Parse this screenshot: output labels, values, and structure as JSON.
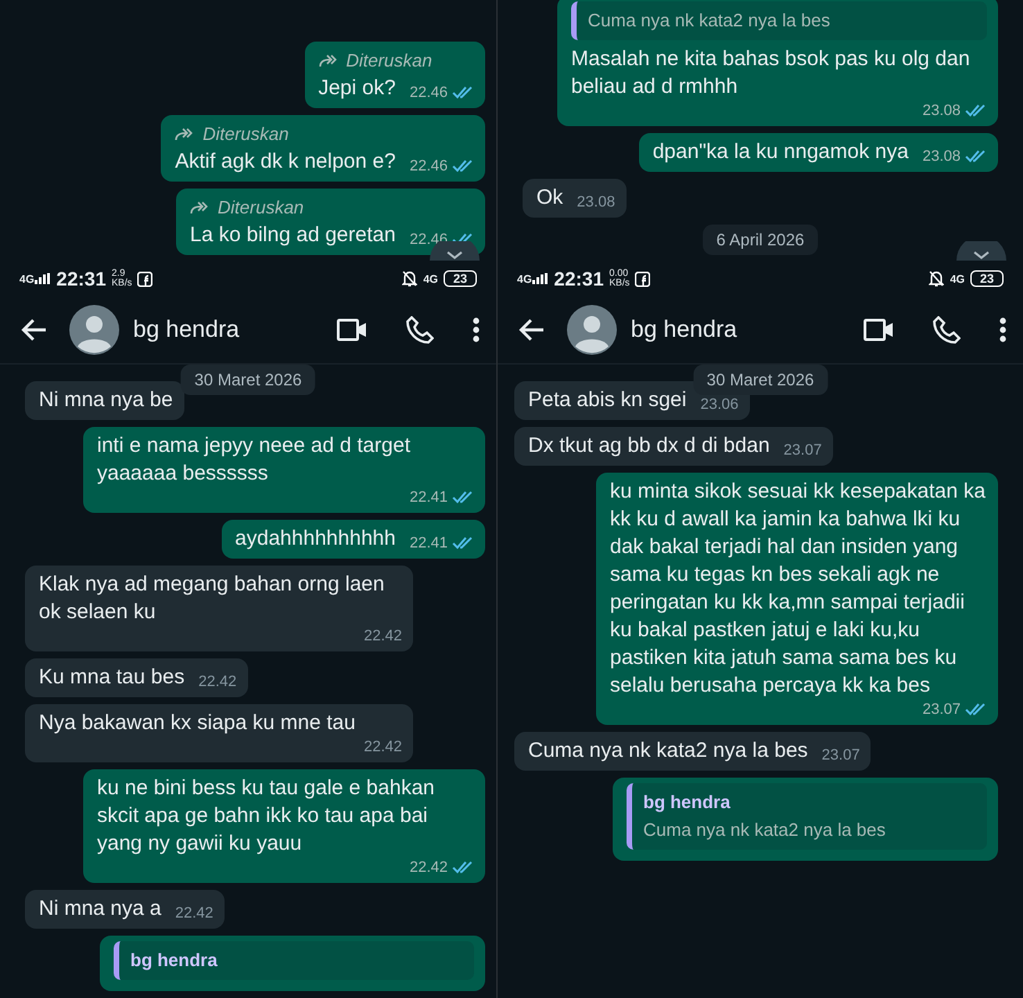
{
  "panels": [
    {
      "kind": "fragment",
      "messages": [
        {
          "kind": "out",
          "forwarded": "Diteruskan",
          "text": "Jepi ok?",
          "time": "22.46",
          "read": true
        },
        {
          "kind": "out",
          "forwarded": "Diteruskan",
          "text": "Aktif agk dk k nelpon e?",
          "time": "22.46",
          "read": true
        },
        {
          "kind": "out",
          "forwarded": "Diteruskan",
          "text": "La ko bilng ad geretan",
          "time": "22.46",
          "read": true
        }
      ]
    },
    {
      "kind": "fragment",
      "messages": [
        {
          "kind": "out",
          "reply": {
            "text": "Cuma nya nk kata2 nya la bes"
          },
          "text": "Masalah ne kita bahas bsok pas ku olg dan beliau ad d rmhhh",
          "time": "23.08",
          "read": true
        },
        {
          "kind": "out",
          "text": "dpan\"ka la ku nngamok nya",
          "time": "23.08",
          "read": true
        },
        {
          "kind": "in",
          "text": "Ok",
          "time": "23.08"
        },
        {
          "kind": "date",
          "text": "6 April 2026"
        }
      ]
    },
    {
      "kind": "phone",
      "status_bar": {
        "network": "4G",
        "time": "22:31",
        "speed": "2.9",
        "speed_unit": "KB/s",
        "network_right": "4G",
        "battery": "23"
      },
      "contact": "bg hendra",
      "date_chip": "30 Maret 2026",
      "messages": [
        {
          "kind": "in",
          "text": "Ni mna nya be"
        },
        {
          "kind": "out",
          "text": "inti e nama jepyy neee ad d target yaaaaaa bessssss",
          "time": "22.41",
          "read": true
        },
        {
          "kind": "out",
          "text": "aydahhhhhhhhhh",
          "time": "22.41",
          "read": true
        },
        {
          "kind": "in",
          "text": "Klak nya ad megang bahan orng laen ok selaen ku",
          "time": "22.42"
        },
        {
          "kind": "in",
          "text": "Ku mna tau bes",
          "time": "22.42"
        },
        {
          "kind": "in",
          "text": "Nya bakawan kx siapa ku mne tau",
          "time": "22.42"
        },
        {
          "kind": "out",
          "text": "ku ne bini bess ku tau gale e bahkan skcit apa ge bahn ikk ko tau apa bai yang ny gawii ku yauu",
          "time": "22.42",
          "read": true
        },
        {
          "kind": "in",
          "text": "Ni mna nya a",
          "time": "22.42"
        },
        {
          "kind": "out",
          "reply": {
            "name": "bg hendra"
          }
        }
      ]
    },
    {
      "kind": "phone",
      "status_bar": {
        "network": "4G",
        "time": "22:31",
        "speed": "0.00",
        "speed_unit": "KB/s",
        "network_right": "4G",
        "battery": "23"
      },
      "contact": "bg hendra",
      "date_chip": "30 Maret 2026",
      "messages": [
        {
          "kind": "in",
          "text": "Peta abis kn sgei",
          "time": "23.06"
        },
        {
          "kind": "in",
          "text": "Dx tkut ag bb dx d di bdan",
          "time": "23.07"
        },
        {
          "kind": "out",
          "text": "ku minta sikok sesuai kk kesepakatan ka kk ku d awall ka jamin ka bahwa lki ku dak bakal terjadi hal dan insiden yang sama ku tegas kn bes sekali agk ne peringatan ku kk ka,mn sampai terjadii ku bakal pastken jatuj e laki ku,ku pastiken kita jatuh sama sama bes ku selalu berusaha percaya kk ka bes",
          "time": "23.07",
          "read": true
        },
        {
          "kind": "in",
          "text": "Cuma nya nk kata2 nya la bes",
          "time": "23.07"
        },
        {
          "kind": "out",
          "reply": {
            "name": "bg hendra",
            "text": "Cuma nya nk kata2 nya la bes"
          }
        }
      ]
    }
  ]
}
